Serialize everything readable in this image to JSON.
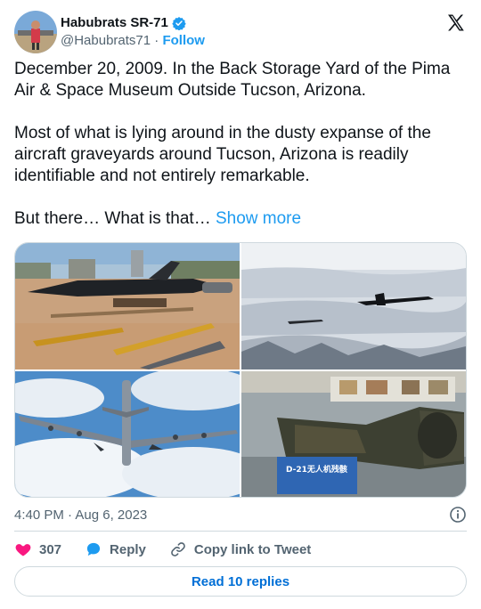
{
  "author": {
    "display_name": "Habubrats SR-71",
    "handle": "@Habubrats71",
    "separator": "·",
    "follow_label": "Follow"
  },
  "tweet": {
    "paragraph_1": "December 20, 2009. In the Back Storage Yard of the Pima Air & Space Museum Outside Tucson, Arizona.",
    "paragraph_2": "Most of what is lying around in the dusty expanse of the aircraft graveyards around Tucson, Arizona is readily identifiable and not entirely remarkable.",
    "paragraph_3": "But there… What is that…",
    "show_more": "Show more"
  },
  "media": {
    "photo_4_sign": "D-21无人机残骸"
  },
  "meta": {
    "timestamp": "4:40 PM · Aug 6, 2023"
  },
  "actions": {
    "likes": "307",
    "reply": "Reply",
    "copy_link": "Copy link to Tweet"
  },
  "footer": {
    "read_replies": "Read 10 replies"
  },
  "icons": [
    "verified-badge-icon",
    "x-logo-icon",
    "info-icon",
    "heart-icon",
    "reply-bubble-icon",
    "link-icon"
  ],
  "colors": {
    "accent": "#1d9bf0",
    "like": "#f91880",
    "muted": "#536471",
    "border": "#cfd9de"
  }
}
